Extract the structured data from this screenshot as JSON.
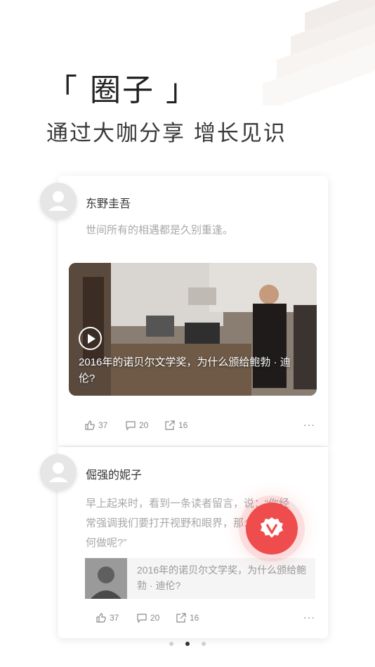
{
  "header": {
    "title": "「 圈子 」",
    "subtitle": "通过大咖分享  增长见识"
  },
  "posts": [
    {
      "author": "东野圭吾",
      "quote": "世间所有的相遇都是久别重逢。",
      "video": {
        "title": "2016年的诺贝尔文学奖，为什么颁给鲍勃 · 迪伦?"
      },
      "actions": {
        "likes": "37",
        "comments": "20",
        "shares": "16"
      },
      "more": "···"
    },
    {
      "author": "倔强的妮子",
      "quote": "早上起来时，看到一条读者留言，说：“你经常强调我们要打开视野和眼界，那么，应该如何做呢?”",
      "link": {
        "title": "2016年的诺贝尔文学奖，为什么颁给鲍勃 · 迪伦?"
      },
      "actions": {
        "likes": "37",
        "comments": "20",
        "shares": "16"
      },
      "more": "···"
    }
  ],
  "pagination": {
    "total": 3,
    "active": 1
  },
  "colors": {
    "accent": "#ef4d4d",
    "text_muted": "#a8a8a8"
  },
  "icons": [
    "like-icon",
    "comment-icon",
    "share-icon",
    "play-icon",
    "avatar-placeholder-icon",
    "v-badge-icon"
  ]
}
